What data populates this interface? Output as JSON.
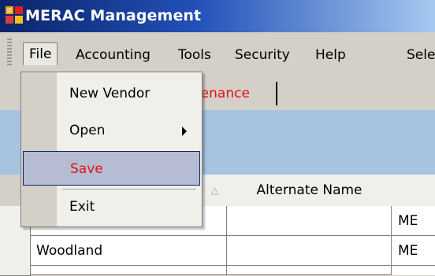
{
  "window": {
    "title": "MERAC Management"
  },
  "menubar": {
    "items": [
      "File",
      "Accounting",
      "Tools",
      "Security",
      "Help",
      "Sele"
    ]
  },
  "tab": {
    "label": "tenance"
  },
  "file_menu": {
    "items": [
      "New Vendor",
      "Open",
      "Save",
      "Exit"
    ],
    "highlighted": "Save"
  },
  "grid": {
    "headers": [
      "",
      "Alternate Name",
      ""
    ],
    "sort_glyph": "△",
    "rows": [
      {
        "name": "",
        "alt": "",
        "state": "ME"
      },
      {
        "name": "Woodland",
        "alt": "",
        "state": "ME"
      }
    ]
  },
  "colors": {
    "title_start": "#0a246a",
    "title_end": "#a6caf0",
    "panel": "#a7c3e0",
    "highlight_text": "#e0101a"
  }
}
